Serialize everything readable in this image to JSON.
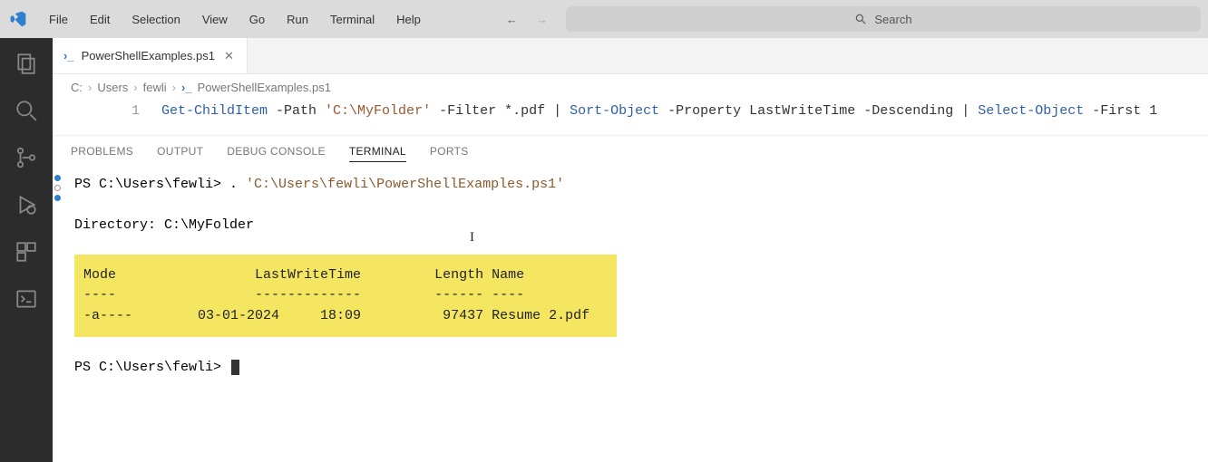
{
  "menu": {
    "file": "File",
    "edit": "Edit",
    "selection": "Selection",
    "view": "View",
    "go": "Go",
    "run": "Run",
    "terminal": "Terminal",
    "help": "Help"
  },
  "search": {
    "placeholder": "Search"
  },
  "tab": {
    "filename": "PowerShellExamples.ps1"
  },
  "breadcrumbs": {
    "c": "C:",
    "users": "Users",
    "user": "fewli",
    "file": "PowerShellExamples.ps1"
  },
  "editor": {
    "lineno": "1",
    "tokens": {
      "cmd1": "Get-ChildItem",
      "p1": " -Path ",
      "str1": "'C:\\MyFolder'",
      "p2": " -Filter *.pdf ",
      "pipe1": "|",
      "cmd2": " Sort-Object",
      "p3": " -Property LastWriteTime -Descending ",
      "pipe2": "|",
      "cmd3": " Select-Object",
      "p4": " -First 1"
    }
  },
  "panel": {
    "problems": "PROBLEMS",
    "output": "OUTPUT",
    "debug": "DEBUG CONSOLE",
    "terminal": "TERMINAL",
    "ports": "PORTS"
  },
  "terminal": {
    "prompt1": "PS C:\\Users\\fewli> ",
    "dot": ". ",
    "scriptpath": "'C:\\Users\\fewli\\PowerShellExamples.ps1'",
    "dirline": "    Directory: C:\\MyFolder",
    "table_header": "Mode                 LastWriteTime         Length Name",
    "table_sep": "----                 -------------         ------ ----",
    "table_row": "-a----        03-01-2024     18:09          97437 Resume 2.pdf",
    "prompt2": "PS C:\\Users\\fewli> "
  }
}
